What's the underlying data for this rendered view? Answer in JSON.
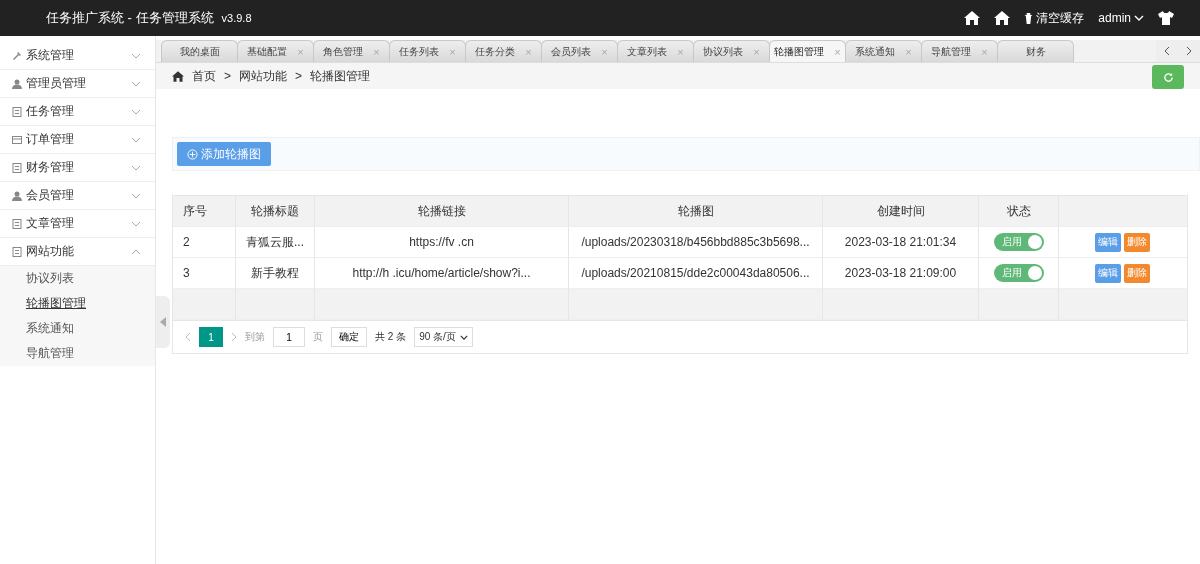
{
  "header": {
    "title": "任务推广系统 - 任务管理系统",
    "version": "v3.9.8",
    "clear_cache": "清空缓存",
    "user": "admin"
  },
  "sidebar": {
    "items": [
      {
        "label": "系统管理",
        "kind": "tools",
        "expanded": false
      },
      {
        "label": "管理员管理",
        "kind": "user",
        "expanded": false
      },
      {
        "label": "任务管理",
        "kind": "list",
        "expanded": false
      },
      {
        "label": "订单管理",
        "kind": "window",
        "expanded": false
      },
      {
        "label": "财务管理",
        "kind": "list",
        "expanded": false
      },
      {
        "label": "会员管理",
        "kind": "user",
        "expanded": false
      },
      {
        "label": "文章管理",
        "kind": "list",
        "expanded": false
      },
      {
        "label": "网站功能",
        "kind": "list",
        "expanded": true,
        "children": [
          {
            "label": "协议列表",
            "selected": false
          },
          {
            "label": "轮播图管理",
            "selected": true
          },
          {
            "label": "系统通知",
            "selected": false
          },
          {
            "label": "导航管理",
            "selected": false
          }
        ]
      }
    ]
  },
  "tabs": [
    {
      "label": "我的桌面",
      "selected": false
    },
    {
      "label": "基础配置",
      "close": "×",
      "selected": false
    },
    {
      "label": "角色管理",
      "close": "×",
      "selected": false
    },
    {
      "label": "任务列表",
      "close": "×",
      "selected": false
    },
    {
      "label": "任务分类",
      "close": "×",
      "selected": false
    },
    {
      "label": "会员列表",
      "close": "×",
      "selected": false
    },
    {
      "label": "文章列表",
      "close": "×",
      "selected": false
    },
    {
      "label": "协议列表",
      "close": "×",
      "selected": false
    },
    {
      "label": "轮播图管理",
      "close": "×",
      "selected": true
    },
    {
      "label": "系统通知",
      "close": "×",
      "selected": false
    },
    {
      "label": "导航管理",
      "close": "×",
      "selected": false
    },
    {
      "label": "财务",
      "selected": false
    }
  ],
  "breadcrumb": {
    "separator": ">",
    "items": [
      "首页",
      "网站功能",
      "轮播图管理"
    ]
  },
  "add_button": "添加轮播图",
  "table": {
    "columns": [
      "序号",
      "轮播标题",
      "轮播链接",
      "轮播图",
      "创建时间",
      "状态"
    ],
    "rows": [
      {
        "cells": [
          "2",
          "青狐云服...",
          "https://fv          .cn",
          "/uploads/20230318/b456bbd885c3b5698...",
          "2023-03-18 21:01:34"
        ],
        "status": "启用",
        "on": true,
        "actions": [
          "编辑",
          "删除"
        ]
      },
      {
        "cells": [
          "3",
          "新手教程",
          "http://h          .icu/home/article/show?i...",
          "/uploads/20210815/dde2c00043da80506...",
          "2023-03-18 21:09:00"
        ],
        "status": "启用",
        "on": true,
        "actions": [
          "编辑",
          "删除"
        ]
      }
    ]
  },
  "pagination": {
    "pages": [
      {
        "label": "1",
        "selected": true
      }
    ],
    "goto_label": "到第",
    "page_input": "1",
    "page_unit": "页",
    "confirm": "确定",
    "total": "共 2 条",
    "page_size": "90 条/页"
  }
}
